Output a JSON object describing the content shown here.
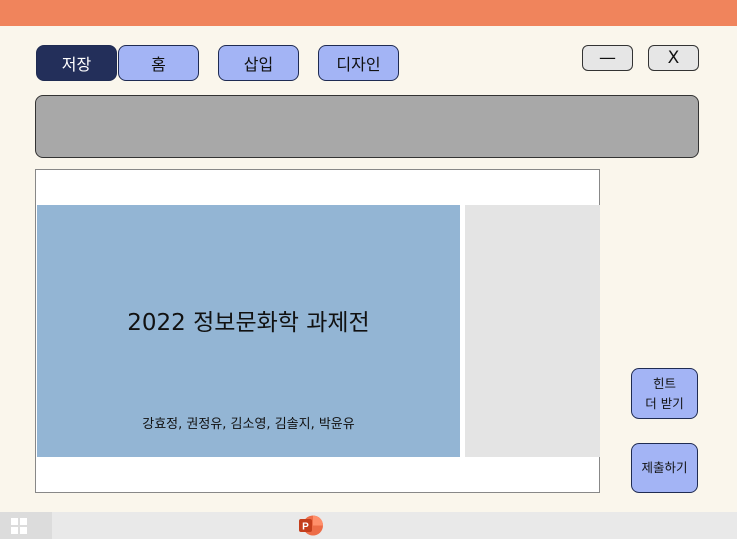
{
  "toolbar": {
    "tabs": [
      {
        "label": "저장",
        "active": true
      },
      {
        "label": "홈",
        "active": false
      },
      {
        "label": "삽입",
        "active": false
      },
      {
        "label": "디자인",
        "active": false
      }
    ],
    "minimize_label": "—",
    "close_label": "X"
  },
  "slide": {
    "title": "2022 정보문화학 과제전",
    "authors": "강효정, 권정유, 김소영, 김솔지, 박윤유"
  },
  "side_buttons": {
    "hint_line1": "힌트",
    "hint_line2": "더 받기",
    "submit": "제출하기"
  },
  "taskbar": {
    "start_icon": "windows-logo-icon",
    "app_icon": "powerpoint-icon",
    "app_icon_letter": "P"
  },
  "colors": {
    "title_bar": "#f0845c",
    "active_tab": "#232f5a",
    "tab": "#a3b4f5",
    "ribbon": "#a8a8a8",
    "slide_background": "#93b5d4",
    "powerpoint": "#d24726"
  }
}
